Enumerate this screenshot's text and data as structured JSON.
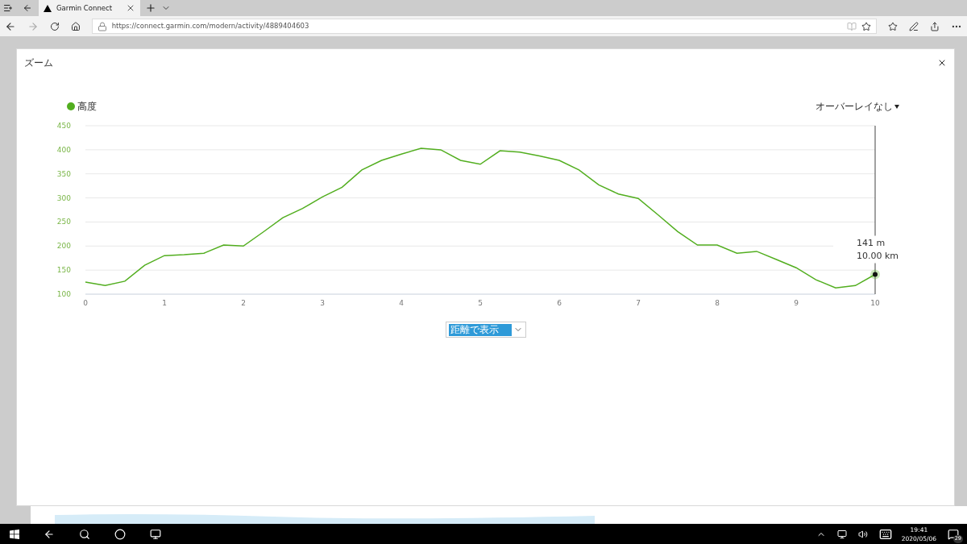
{
  "browser": {
    "tab_title": "Garmin Connect",
    "url": "https://connect.garmin.com/modern/activity/4889404603"
  },
  "dialog": {
    "title": "ズーム",
    "tooltip": {
      "lines": [
        "141 m",
        "10.00 km"
      ]
    },
    "overlay_select": {
      "value": "オーバーレイなし"
    },
    "chart_data": {
      "type": "line",
      "x": [
        0,
        0.25,
        0.5,
        0.75,
        1,
        1.25,
        1.5,
        1.75,
        2,
        2.25,
        2.5,
        2.75,
        3,
        3.25,
        3.5,
        3.75,
        4,
        4.25,
        4.5,
        4.75,
        5,
        5.25,
        5.5,
        5.75,
        6,
        6.25,
        6.5,
        6.75,
        7,
        7.25,
        7.5,
        7.75,
        8,
        8.25,
        8.5,
        8.75,
        9,
        9.25,
        9.5,
        9.75,
        10
      ],
      "series": [
        {
          "name": "高度",
          "color": "#52ae1f",
          "values": [
            125,
            118,
            127,
            160,
            180,
            182,
            185,
            202,
            200,
            229,
            259,
            278,
            302,
            322,
            358,
            378,
            391,
            403,
            400,
            378,
            370,
            398,
            395,
            387,
            378,
            358,
            327,
            308,
            299,
            265,
            230,
            202,
            202,
            185,
            189,
            172,
            155,
            130,
            113,
            118,
            141
          ]
        }
      ],
      "xlim": [
        0,
        10
      ],
      "ylim": [
        100,
        450
      ],
      "xticks": [
        0,
        1,
        2,
        3,
        4,
        5,
        6,
        7,
        8,
        9,
        10
      ],
      "yticks": [
        100,
        150,
        200,
        250,
        300,
        350,
        400,
        450
      ],
      "grid": true
    },
    "view_select": {
      "value": "距離で表示"
    }
  },
  "taskbar": {
    "time": "19:41",
    "date": "2020/05/06",
    "notifications": "29"
  }
}
